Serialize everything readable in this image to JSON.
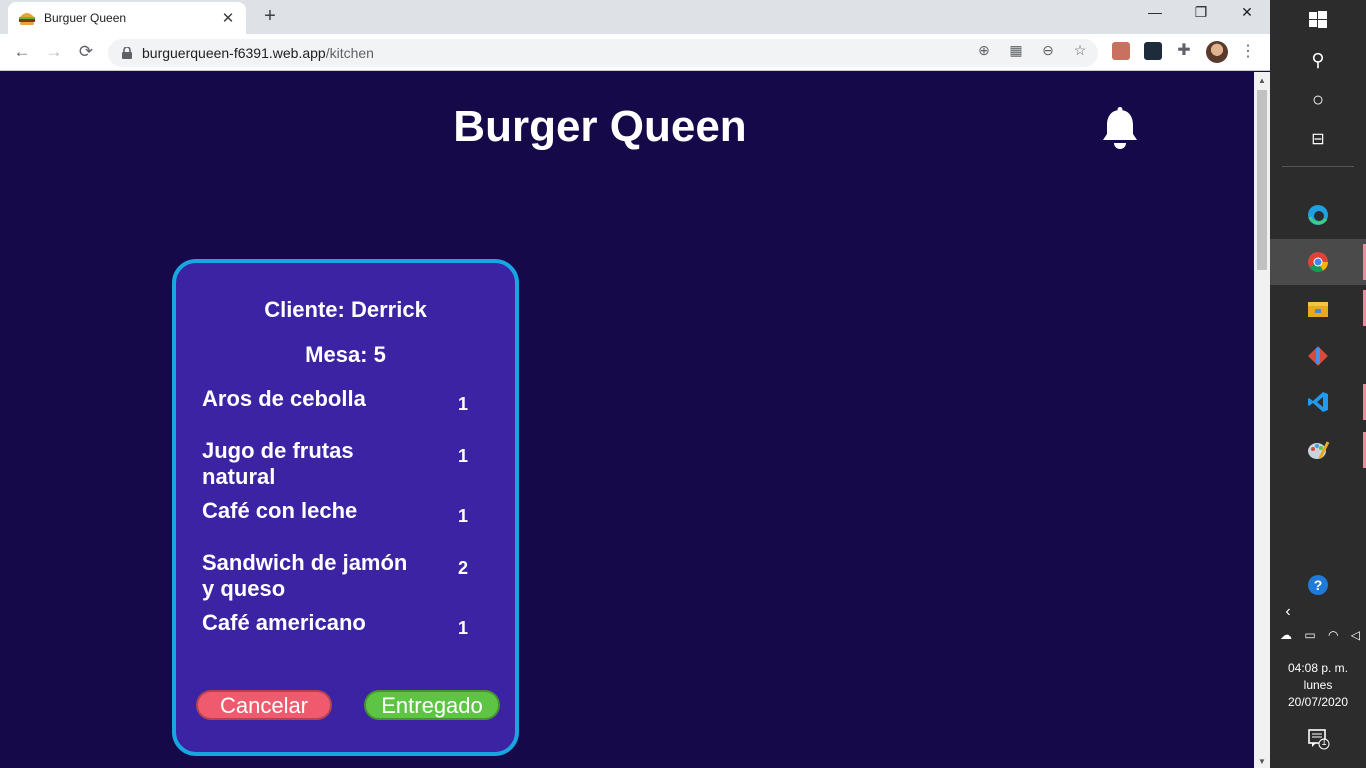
{
  "browser": {
    "tab_title": "Burguer Queen",
    "tab_close": "✕",
    "new_tab": "+",
    "url_host": "burguerqueen-f6391.web.app",
    "url_path": "/kitchen",
    "window_controls": [
      "—",
      "❐",
      "✕"
    ]
  },
  "page": {
    "brand": "Burger Queen",
    "order": {
      "client_label": "Cliente: Derrick",
      "table_label": "Mesa: 5",
      "items": [
        {
          "name": "Aros de cebolla",
          "qty": "1"
        },
        {
          "name": "Jugo de frutas natural",
          "qty": "1"
        },
        {
          "name": "Café con leche",
          "qty": "1"
        },
        {
          "name": "Sandwich de jamón y queso",
          "qty": "2"
        },
        {
          "name": "Café americano",
          "qty": "1"
        }
      ],
      "cancel_label": "Cancelar",
      "deliver_label": "Entregado"
    },
    "colors": {
      "background": "#16094a",
      "card": "#3b23a3",
      "card_border": "#18a6e0",
      "cancel": "#f05a6e",
      "deliver": "#5ec443"
    }
  },
  "taskbar": {
    "time": "04:08 p. m.",
    "day": "lunes",
    "date": "20/07/2020",
    "notification_count": "1"
  }
}
